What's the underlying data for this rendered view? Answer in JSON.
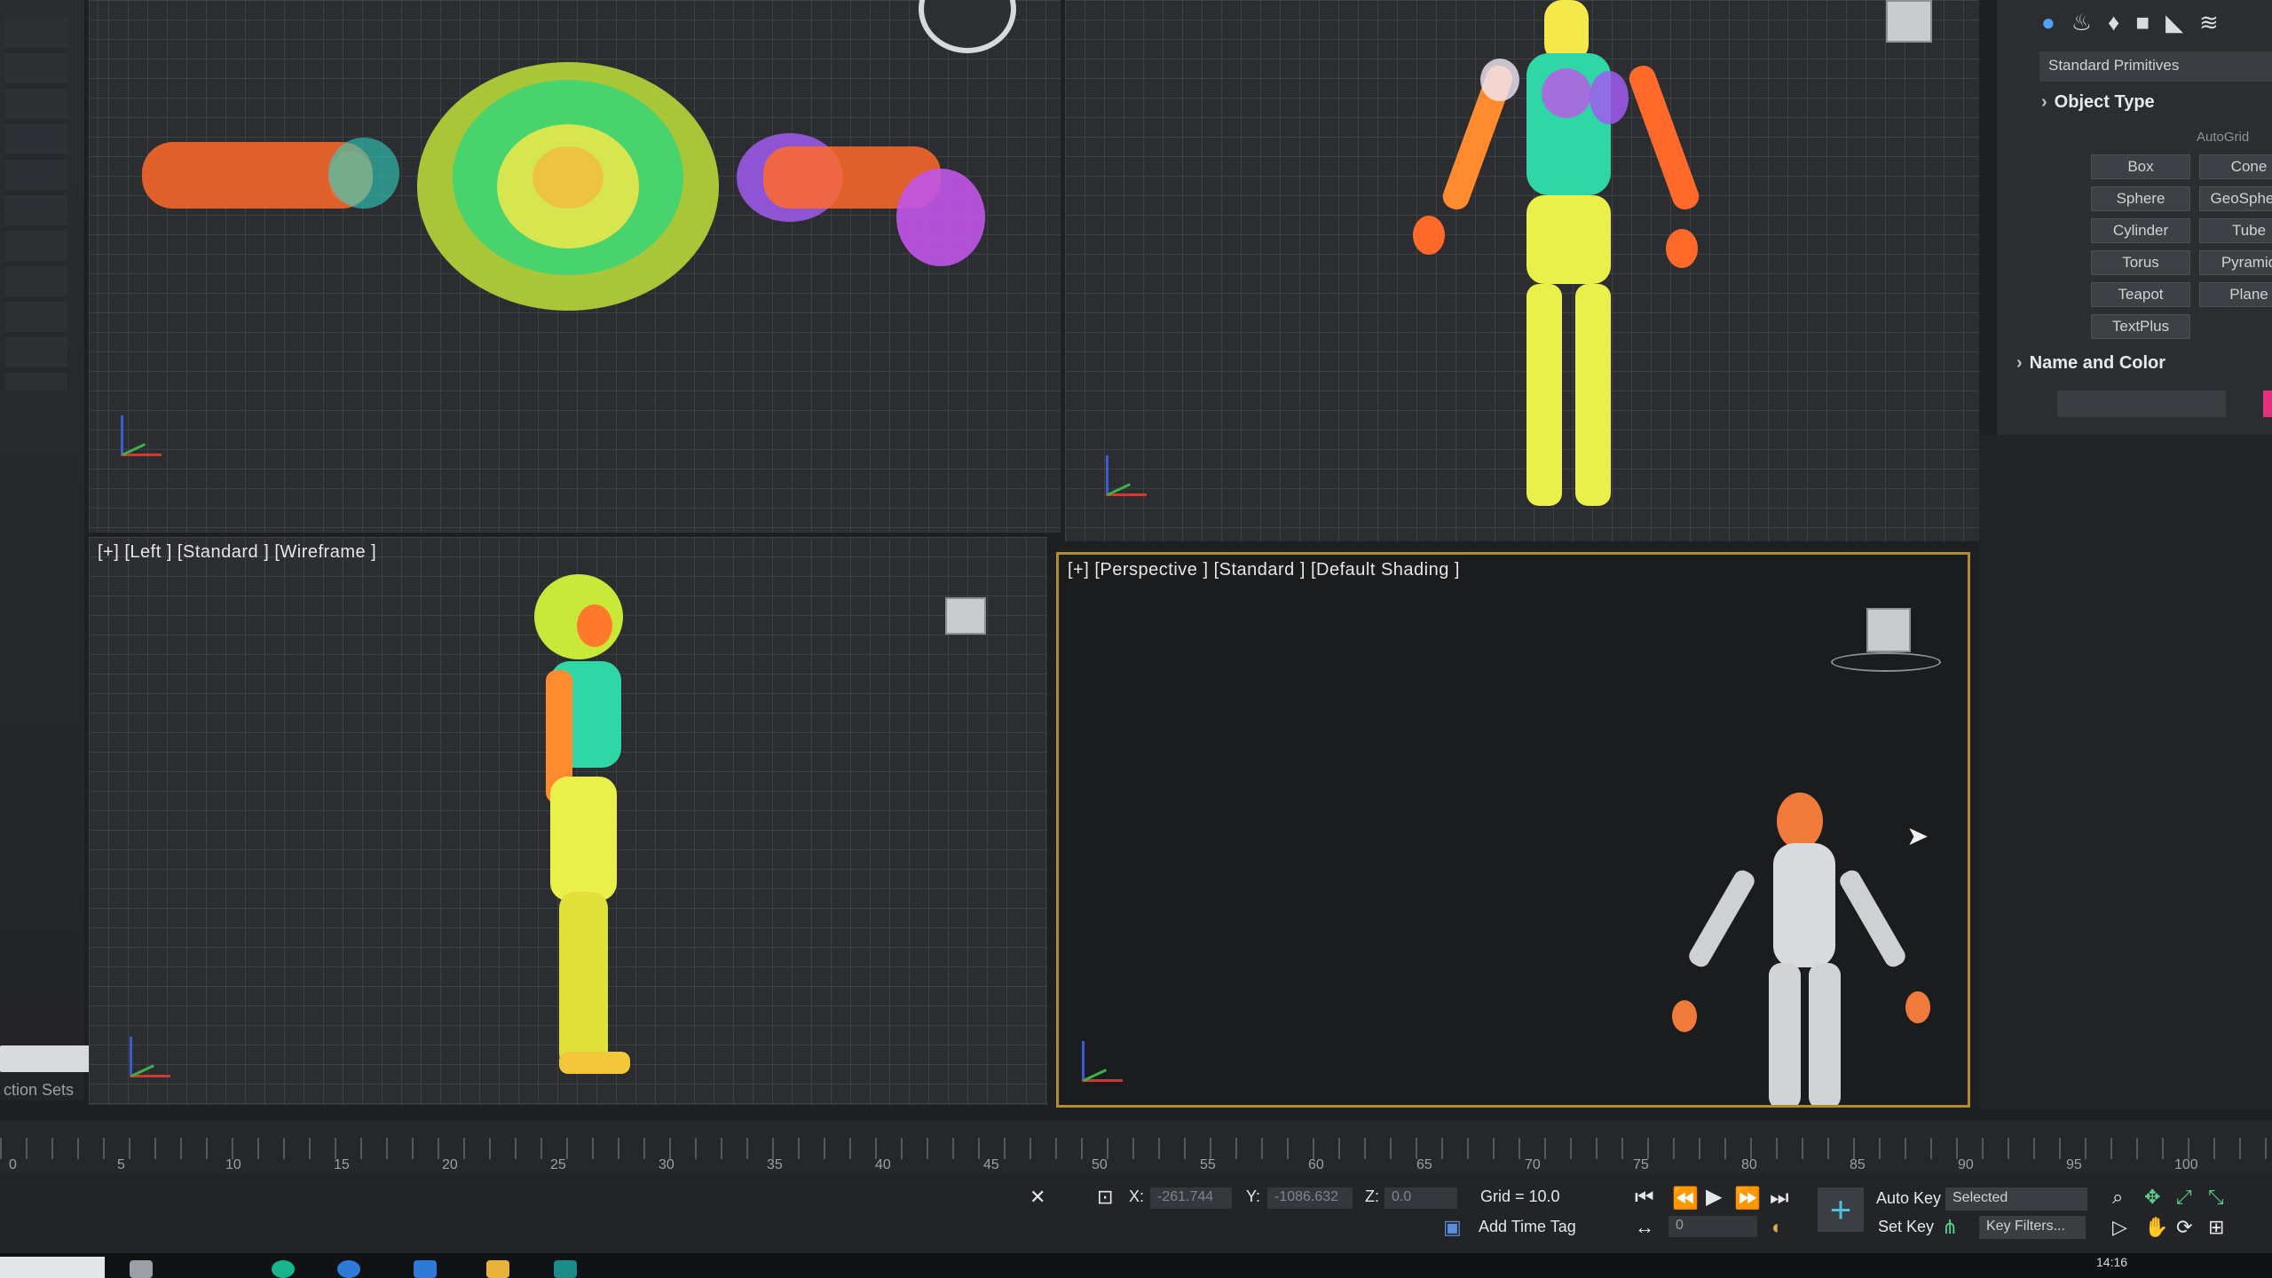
{
  "viewports": {
    "left_label": "[+] [Left ] [Standard ] [Wireframe ]",
    "perspective_label": "[+] [Perspective ] [Standard ] [Default Shading ]"
  },
  "command_panel": {
    "toolbar_icons": [
      "geometry-icon",
      "shapes-icon",
      "lights-icon",
      "cameras-icon",
      "helpers-icon",
      "space-warps-icon",
      "systems-icon"
    ],
    "category_dropdown": "Standard Primitives",
    "object_type_title": "Object Type",
    "autogrid_label": "AutoGrid",
    "object_buttons": [
      "Box",
      "Cone",
      "Sphere",
      "GeoSphere",
      "Cylinder",
      "Tube",
      "Torus",
      "Pyramid",
      "Teapot",
      "Plane",
      "TextPlus"
    ],
    "name_color_title": "Name and Color",
    "color_accent": "#e4317d"
  },
  "left_panel": {
    "label": "ction Sets"
  },
  "timeline": {
    "ticks": [
      "0",
      "5",
      "10",
      "15",
      "20",
      "25",
      "30",
      "35",
      "40",
      "45",
      "50",
      "55",
      "60",
      "65",
      "70",
      "75",
      "80",
      "85",
      "90",
      "95",
      "100"
    ]
  },
  "status_bar": {
    "x_label": "X:",
    "x_value": "-261.744",
    "y_label": "Y:",
    "y_value": "-1086.632",
    "z_label": "Z:",
    "z_value": "0.0",
    "grid_label": "Grid = 10.0",
    "add_time_tag": "Add Time Tag",
    "auto_key": "Auto Key",
    "key_mode": "Selected",
    "set_key": "Set Key",
    "key_filters": "Key Filters...",
    "frame_value": "0",
    "clock": "14:16"
  }
}
